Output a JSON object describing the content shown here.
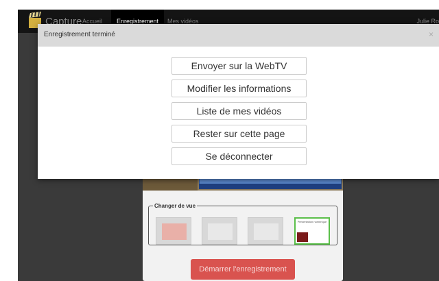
{
  "navbar": {
    "brand": "Capture",
    "items": [
      "Accueil",
      "Enregistrement",
      "Mes vidéos"
    ],
    "active_item": "Enregistrement",
    "user": "Julie Ro"
  },
  "panel": {
    "legend": "Changer de vue",
    "start_button": "Démarrer l'enregistrement",
    "thumb_slide_text": "Présentation numérique"
  },
  "modal": {
    "title": "Enregistrement terminé",
    "close_icon": "×",
    "actions": [
      "Envoyer sur la WebTV",
      "Modifier les informations",
      "Liste de mes vidéos",
      "Rester sur cette page",
      "Se déconnecter"
    ]
  },
  "colors": {
    "navbar_bg": "#141414",
    "modal_header_bg": "#dadada",
    "start_button_bg": "#d9534f",
    "selected_thumb_border": "#5bbf4a"
  }
}
